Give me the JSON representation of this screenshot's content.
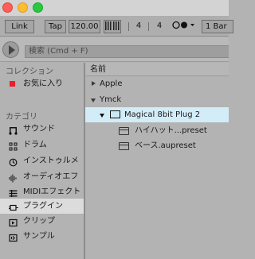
{
  "control_bar": {
    "link_label": "Link",
    "tap_label": "Tap",
    "tempo_value": "120.00",
    "nudge_icon": "nudge-bars-icon",
    "time_signature_numerator": "4",
    "time_signature_denominator": "4",
    "metronome_icon": "metronome-icon",
    "quantize_label": "1 Bar"
  },
  "search": {
    "placeholder": "検索 (Cmd + F)"
  },
  "sidebar": {
    "collections_heading": "コレクション",
    "favorites_label": "お気に入り",
    "favorites_color": "#e8202a",
    "categories_heading": "カテゴリ",
    "categories": [
      {
        "label": "サウンド",
        "icon": "note-icon"
      },
      {
        "label": "ドラム",
        "icon": "grid-icon"
      },
      {
        "label": "インストゥルメ",
        "icon": "clock-icon"
      },
      {
        "label": "オーディオエフ",
        "icon": "waveform-icon"
      },
      {
        "label": "MIDIエフェクト",
        "icon": "midi-icon"
      },
      {
        "label": "プラグイン",
        "icon": "plug-icon"
      },
      {
        "label": "クリップ",
        "icon": "clip-icon"
      },
      {
        "label": "サンプル",
        "icon": "sample-icon"
      }
    ],
    "selected_category": "プラグイン"
  },
  "browser": {
    "column_header": "名前",
    "rows": [
      {
        "label": "Apple",
        "expanded": false
      },
      {
        "label": "Ymck",
        "expanded": true
      },
      {
        "label": "Magical 8bit Plug 2",
        "expanded": true,
        "selected": true
      },
      {
        "label": "ハイハット...preset"
      },
      {
        "label": "ベース.aupreset"
      }
    ],
    "selection_color": "#d2ecf8"
  }
}
